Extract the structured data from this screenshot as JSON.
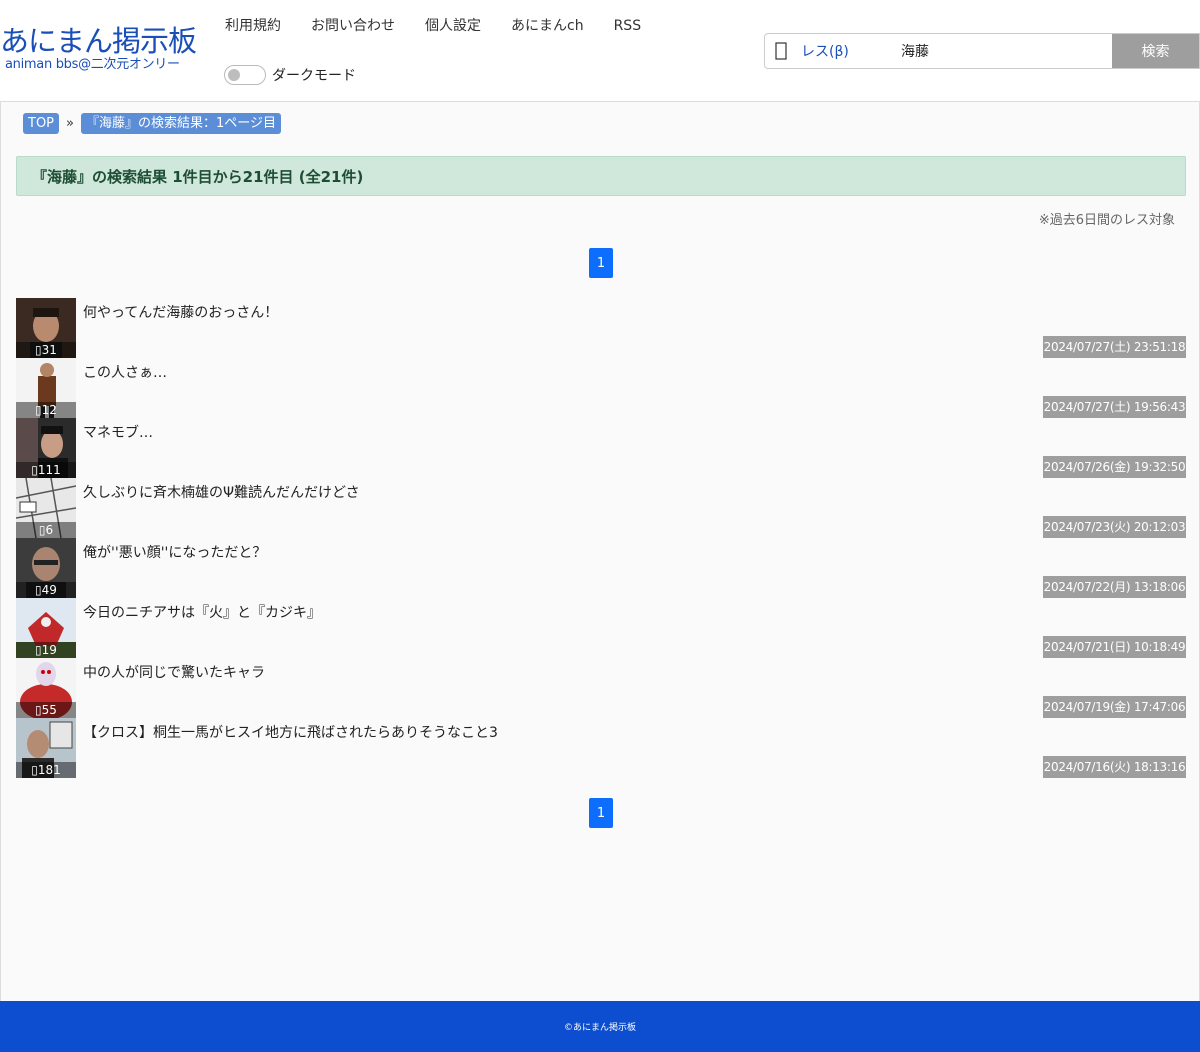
{
  "header": {
    "logo_main": "あにまん掲示板",
    "logo_sub": "animan bbs@二次元オンリー",
    "nav": [
      "利用規約",
      "お問い合わせ",
      "個人設定",
      "あにまんch",
      "RSS"
    ],
    "dark_mode_label": "ダークモード",
    "search_icon_glyph": "🔍",
    "search_type": "レス(β)",
    "search_value": "海藤",
    "search_button": "検索"
  },
  "breadcrumb": {
    "top": "TOP",
    "sep": "»",
    "current": "『海藤』の検索結果：1ページ目"
  },
  "result_header": "『海藤』の検索結果 1件目から21件目 (全21件)",
  "note": "※過去6日間のレス対象",
  "pagination": {
    "current": "1"
  },
  "threads": [
    {
      "title": "何やってんだ海藤のおっさん！",
      "count": "31",
      "date": "2024/07/27(土) 23:51:18"
    },
    {
      "title": "この人さぁ…",
      "count": "12",
      "date": "2024/07/27(土) 19:56:43"
    },
    {
      "title": "マネモブ…",
      "count": "111",
      "date": "2024/07/26(金) 19:32:50"
    },
    {
      "title": "久しぶりに斉木楠雄のΨ難読んだんだけどさ",
      "count": "6",
      "date": "2024/07/23(火) 20:12:03"
    },
    {
      "title": "俺が''悪い顔''になっただと？",
      "count": "49",
      "date": "2024/07/22(月) 13:18:06"
    },
    {
      "title": "今日のニチアサは『火』と『カジキ』",
      "count": "19",
      "date": "2024/07/21(日) 10:18:49"
    },
    {
      "title": "中の人が同じで驚いたキャラ",
      "count": "55",
      "date": "2024/07/19(金) 17:47:06"
    },
    {
      "title": "【クロス】桐生一馬がヒスイ地方に飛ばされたらありそうなこと3",
      "count": "181",
      "date": "2024/07/16(火) 18:13:16"
    }
  ],
  "footer": "©あにまん掲示板"
}
